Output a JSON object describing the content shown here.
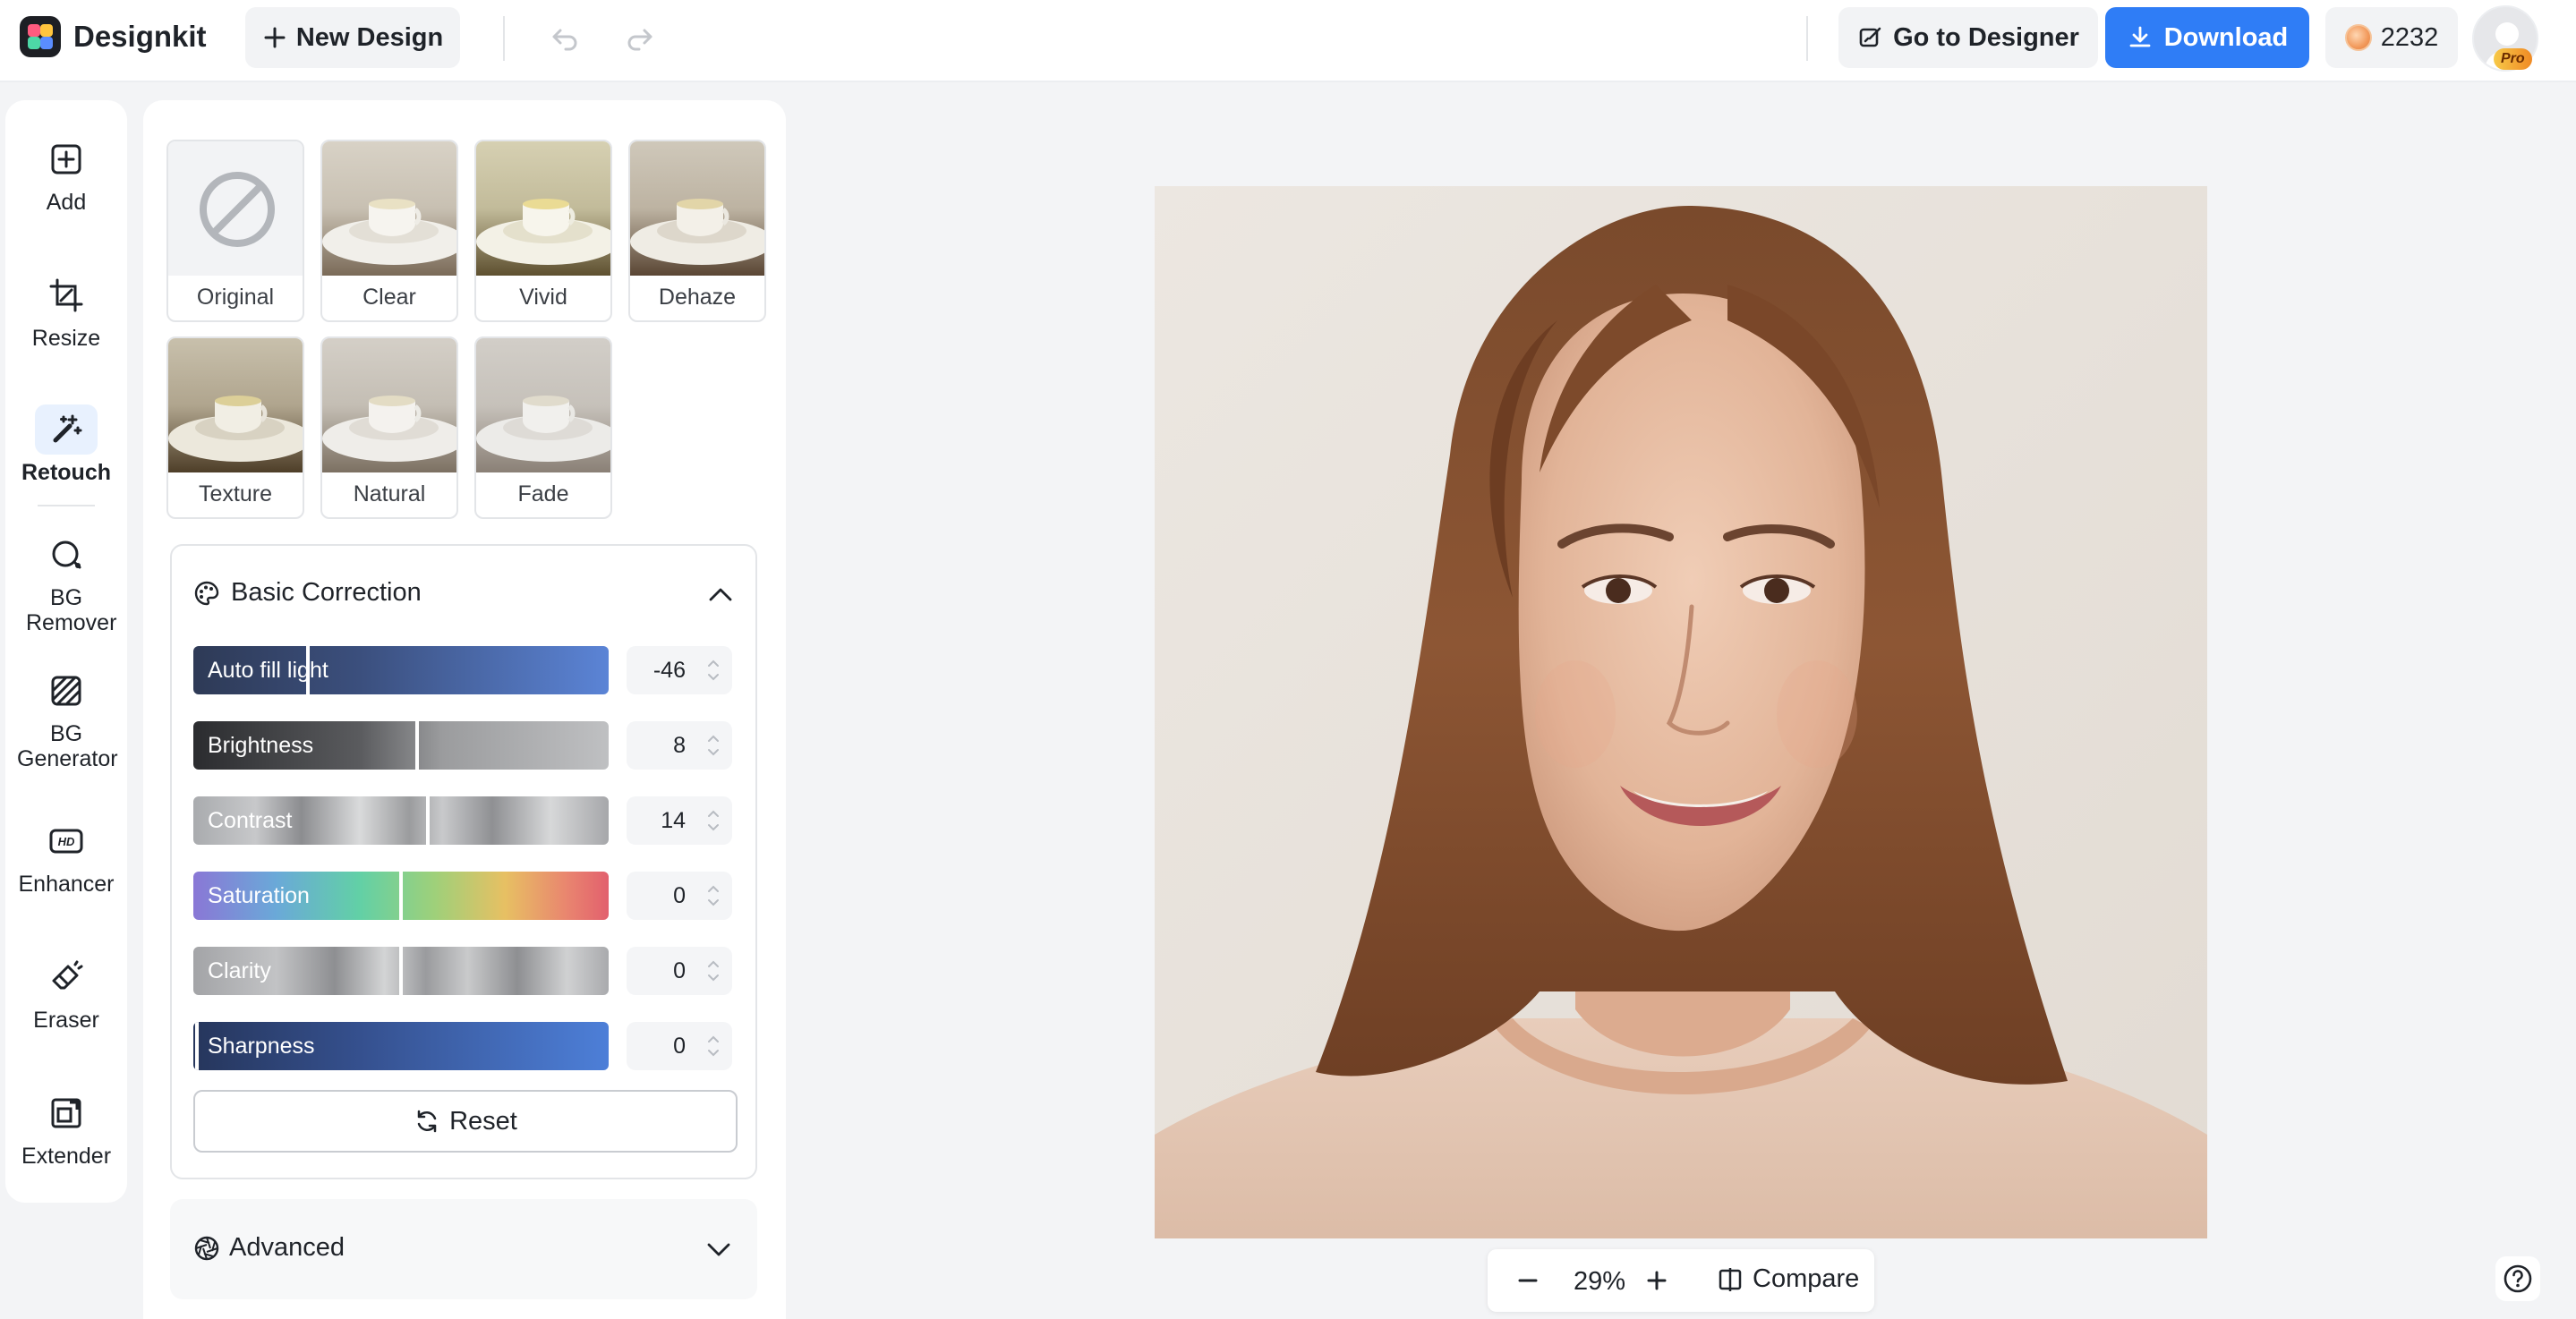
{
  "app": {
    "name": "Designkit"
  },
  "topbar": {
    "new_design_label": "New Design",
    "go_designer_label": "Go to Designer",
    "download_label": "Download",
    "credits": "2232",
    "badge": "Pro"
  },
  "toolbar": {
    "items": [
      {
        "label": "Add",
        "icon": "add-icon"
      },
      {
        "label": "Resize",
        "icon": "crop-icon"
      },
      {
        "label": "Retouch",
        "icon": "magic-wand-icon"
      },
      {
        "label": "BG Remover",
        "icon": "bg-remover-icon"
      },
      {
        "label": "BG Generator",
        "icon": "bg-generator-icon"
      },
      {
        "label": "Enhancer",
        "icon": "hd-icon"
      },
      {
        "label": "Eraser",
        "icon": "eraser-icon"
      },
      {
        "label": "Extender",
        "icon": "extend-icon"
      }
    ],
    "active": "Retouch"
  },
  "filters": [
    {
      "label": "Original"
    },
    {
      "label": "Clear"
    },
    {
      "label": "Vivid"
    },
    {
      "label": "Dehaze"
    },
    {
      "label": "Texture"
    },
    {
      "label": "Natural"
    },
    {
      "label": "Fade"
    }
  ],
  "basic_correction": {
    "title": "Basic Correction",
    "sliders": [
      {
        "label": "Auto fill light",
        "value": "-46"
      },
      {
        "label": "Brightness",
        "value": "8"
      },
      {
        "label": "Contrast",
        "value": "14"
      },
      {
        "label": "Saturation",
        "value": "0"
      },
      {
        "label": "Clarity",
        "value": "0"
      },
      {
        "label": "Sharpness",
        "value": "0"
      }
    ],
    "reset_label": "Reset"
  },
  "advanced": {
    "title": "Advanced"
  },
  "zoom": {
    "level": "29%",
    "compare_label": "Compare"
  },
  "colors": {
    "accent": "#2f7df6",
    "active_tool_bg": "#e8f1fe"
  }
}
